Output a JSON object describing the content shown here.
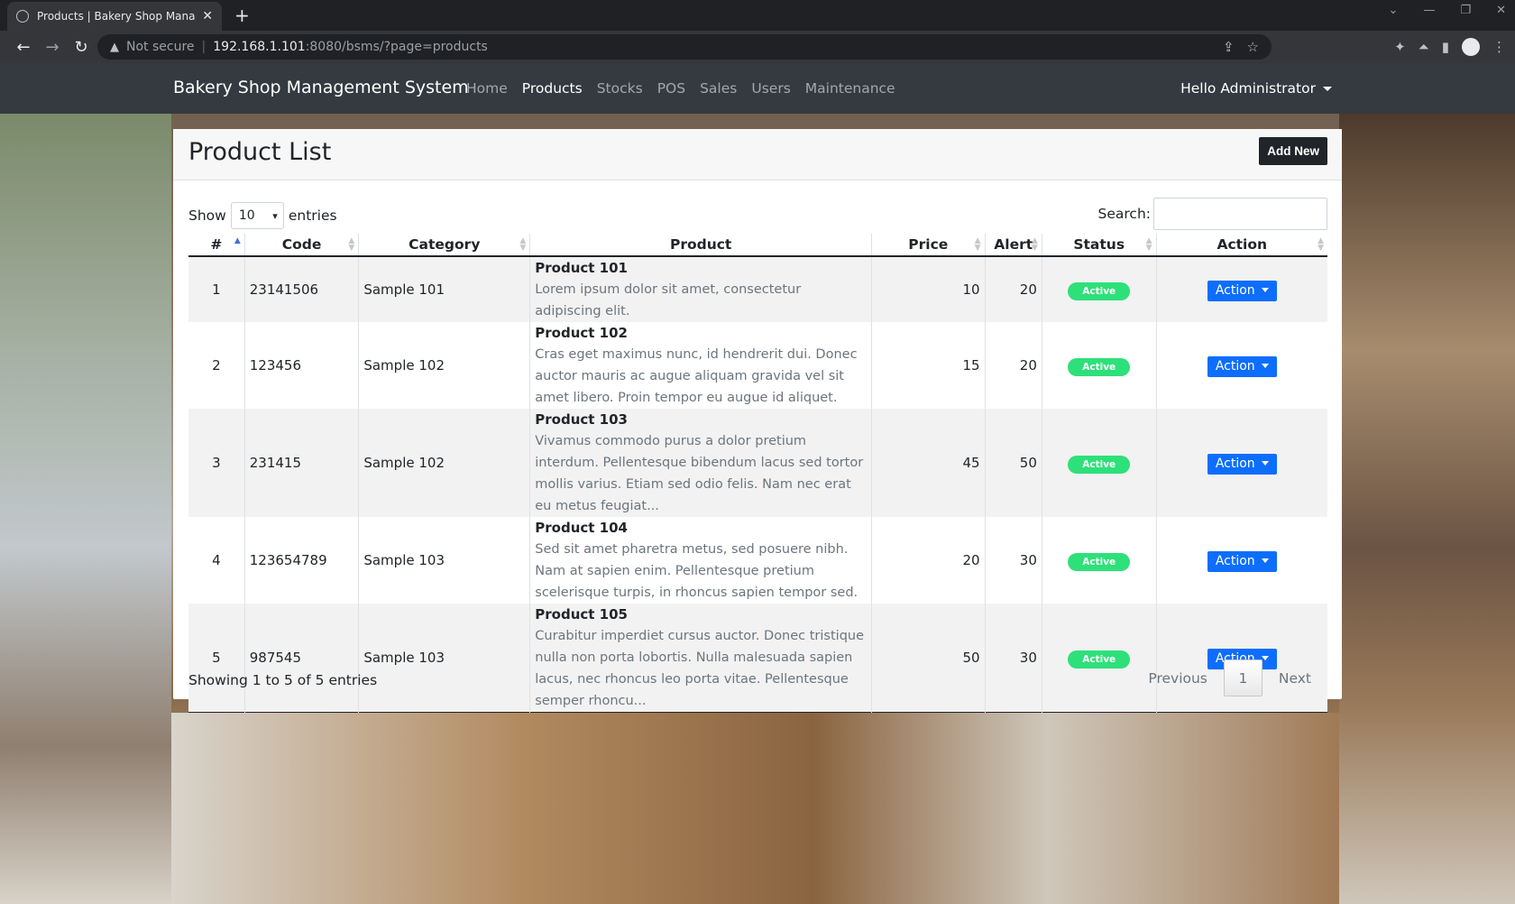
{
  "browser": {
    "tab_title": "Products | Bakery Shop Managem",
    "close_glyph": "✕",
    "new_tab_glyph": "+",
    "security_label": "Not secure",
    "url_host": "192.168.1.101",
    "url_rest": ":8080/bsms/?page=products"
  },
  "navbar": {
    "brand": "Bakery Shop Management System",
    "links": [
      "Home",
      "Products",
      "Stocks",
      "POS",
      "Sales",
      "Users",
      "Maintenance"
    ],
    "active_link": "Products",
    "user_label": "Hello Administrator"
  },
  "card": {
    "title": "Product List",
    "add_new_label": "Add New"
  },
  "datatable": {
    "show_label": "Show",
    "length_value": "10",
    "entries_label": "entries",
    "search_label": "Search:",
    "search_value": "",
    "columns": [
      "#",
      "Code",
      "Category",
      "Product",
      "Price",
      "Alert",
      "Status",
      "Action"
    ],
    "rows": [
      {
        "no": "1",
        "code": "23141506",
        "category": "Sample 101",
        "name": "Product 101",
        "description": "Lorem ipsum dolor sit amet, consectetur adipiscing elit.",
        "price": "10",
        "alert": "20",
        "status": "Active",
        "action": "Action"
      },
      {
        "no": "2",
        "code": "123456",
        "category": "Sample 102",
        "name": "Product 102",
        "description": "Cras eget maximus nunc, id hendrerit dui. Donec auctor mauris ac augue aliquam gravida vel sit amet libero. Proin tempor eu augue id aliquet.",
        "price": "15",
        "alert": "20",
        "status": "Active",
        "action": "Action"
      },
      {
        "no": "3",
        "code": "231415",
        "category": "Sample 102",
        "name": "Product 103",
        "description": "Vivamus commodo purus a dolor pretium interdum. Pellentesque bibendum lacus sed tortor mollis varius. Etiam sed odio felis. Nam nec erat eu metus feugiat...",
        "price": "45",
        "alert": "50",
        "status": "Active",
        "action": "Action"
      },
      {
        "no": "4",
        "code": "123654789",
        "category": "Sample 103",
        "name": "Product 104",
        "description": "Sed sit amet pharetra metus, sed posuere nibh. Nam at sapien enim. Pellentesque pretium scelerisque turpis, in rhoncus sapien tempor sed.",
        "price": "20",
        "alert": "30",
        "status": "Active",
        "action": "Action"
      },
      {
        "no": "5",
        "code": "987545",
        "category": "Sample 103",
        "name": "Product 105",
        "description": "Curabitur imperdiet cursus auctor. Donec tristique nulla non porta lobortis. Nulla malesuada sapien lacus, nec rhoncus leo porta vitae. Pellentesque semper rhoncu...",
        "price": "50",
        "alert": "30",
        "status": "Active",
        "action": "Action"
      }
    ],
    "info": "Showing 1 to 5 of 5 entries",
    "paging": {
      "previous": "Previous",
      "current": "1",
      "next": "Next"
    }
  },
  "colors": {
    "navbar_bg": "#343a40",
    "badge_active": "#2ee07a",
    "action_button": "#0d6efd",
    "add_new_button": "#212529"
  }
}
